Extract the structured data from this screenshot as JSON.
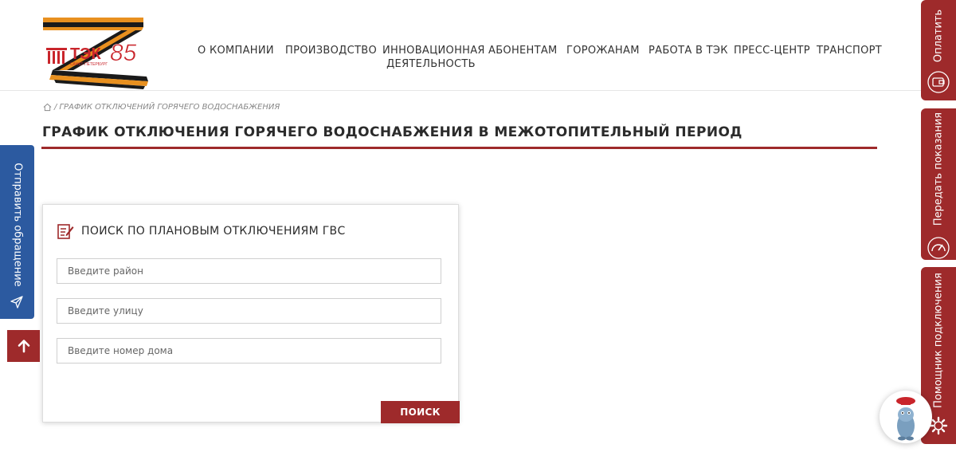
{
  "logo": {
    "text": "ТЭК",
    "year": "85",
    "subtitle": "САНКТ-ПЕТЕРБУРГ"
  },
  "nav": {
    "items": [
      {
        "label": "О КОМПАНИИ"
      },
      {
        "label": "ПРОИЗВОДСТВО"
      },
      {
        "label": "ИННОВАЦИОННАЯ ДЕЯТЕЛЬНОСТЬ"
      },
      {
        "label": "АБОНЕНТАМ"
      },
      {
        "label": "ГОРОЖАНАМ"
      },
      {
        "label": "РАБОТА В ТЭК"
      },
      {
        "label": "ПРЕСС-ЦЕНТР"
      },
      {
        "label": "ТРАНСПОРТ"
      }
    ]
  },
  "breadcrumb": {
    "separator": "/",
    "current": "ГРАФИК ОТКЛЮЧЕНИЙ ГОРЯЧЕГО ВОДОСНАБЖЕНИЯ"
  },
  "page": {
    "title": "ГРАФИК ОТКЛЮЧЕНИЯ ГОРЯЧЕГО ВОДОСНАБЖЕНИЯ В МЕЖОТОПИТЕЛЬНЫЙ ПЕРИОД"
  },
  "search": {
    "title": "ПОИСК ПО ПЛАНОВЫМ ОТКЛЮЧЕНИЯМ ГВС",
    "district_placeholder": "Введите район",
    "street_placeholder": "Введите улицу",
    "house_placeholder": "Введите номер дома",
    "button_label": "ПОИСК"
  },
  "side_left": {
    "feedback_label": "Отправить обращение"
  },
  "side_right": {
    "pay_label": "Оплатить",
    "readings_label": "Передать показания",
    "helper_label": "Помощник подключения"
  },
  "colors": {
    "accent": "#9e2a2b",
    "feedback": "#2c5aa0",
    "text": "#2b2b2b"
  },
  "icons": [
    "home-icon",
    "edit-note-icon",
    "send-icon",
    "arrow-up-icon",
    "wallet-icon",
    "meter-icon",
    "gear-icon",
    "mascot-icon"
  ]
}
